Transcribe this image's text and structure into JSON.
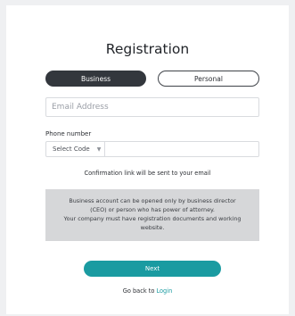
{
  "form": {
    "title": "Registration",
    "tabs": [
      {
        "label": "Business",
        "active": true
      },
      {
        "label": "Personal",
        "active": false
      }
    ],
    "email": {
      "placeholder": "Email Address",
      "value": ""
    },
    "phone": {
      "label": "Phone number",
      "code_select": {
        "value": "Select Code",
        "icon": "chevron-down-icon"
      },
      "number_value": ""
    },
    "confirmation_text": "Confirmation link will be sent to your email",
    "notice": {
      "line1": "Business account can be opened only by business director",
      "line2": "(CEO) or person who has power of attorney.",
      "line3": "Your company must have registration documents and working",
      "line4": "website."
    },
    "next_label": "Next",
    "go_back": {
      "text": "Go back to",
      "link_label": "Login"
    }
  },
  "colors": {
    "accent": "#1a9ba1",
    "active_tab": "#33373d",
    "notice_bg": "#d6d7d9",
    "page_bg": "#eff0f2"
  }
}
